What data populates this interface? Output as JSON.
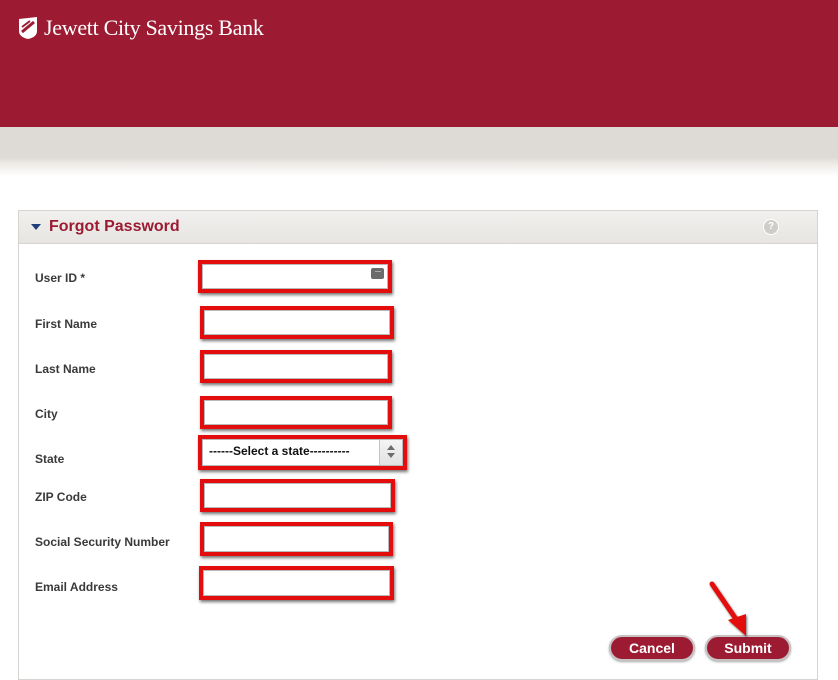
{
  "header": {
    "bank_name": "Jewett City Savings Bank",
    "logo_icon": "bank-shield-logo-icon",
    "brand_color": "#9c1b32"
  },
  "panel": {
    "title": "Forgot Password",
    "collapse_icon": "caret-down-icon",
    "help_icon": "help-icon",
    "help_glyph": "?"
  },
  "form": {
    "user_id_label": "User ID *",
    "user_id_value": "",
    "first_name_label": "First Name",
    "first_name_value": "",
    "last_name_label": "Last Name",
    "last_name_value": "",
    "city_label": "City",
    "city_value": "",
    "state_label": "State",
    "state_selected": "------Select a state----------",
    "zip_label": "ZIP Code",
    "zip_value": "",
    "ssn_label": "Social Security Number",
    "ssn_value": "",
    "email_label": "Email Address",
    "email_value": ""
  },
  "buttons": {
    "cancel_label": "Cancel",
    "submit_label": "Submit"
  },
  "annotation": {
    "highlight_color": "#e30d0d"
  }
}
